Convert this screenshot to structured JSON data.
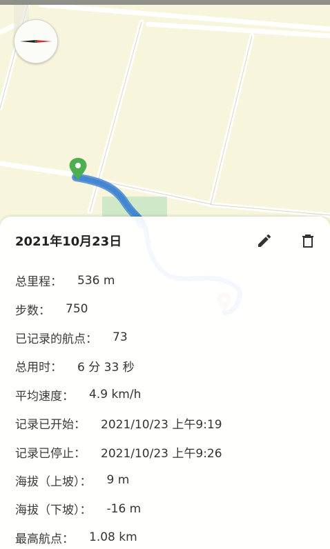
{
  "record": {
    "date": "2021年10月23日"
  },
  "stats": [
    {
      "label": "总里程：",
      "value": "536 m"
    },
    {
      "label": "步数：",
      "value": "750"
    },
    {
      "label": "已记录的航点：",
      "value": "73"
    },
    {
      "label": "总用时：",
      "value": "6 分 33 秒"
    },
    {
      "label": "平均速度：",
      "value": "4.9 km/h"
    },
    {
      "label": "记录已开始：",
      "value": "2021/10/23 上午9:19"
    },
    {
      "label": "记录已停止：",
      "value": "2021/10/23 上午9:26"
    },
    {
      "label": "海拔（上坡）：",
      "value": "9 m"
    },
    {
      "label": "海拔（下坡）：",
      "value": "-16 m"
    },
    {
      "label": "最高航点：",
      "value": "1.08 km"
    }
  ],
  "colors": {
    "track": "#4a90d9",
    "start_marker": "#4caf50",
    "end_marker": "#e57373",
    "map_background": "#f7f5dc",
    "road": "#ffffff"
  },
  "icons": {
    "compass": "compass-icon",
    "edit": "pencil-icon",
    "delete": "trash-icon",
    "start": "start-marker-icon",
    "end": "end-marker-icon"
  }
}
